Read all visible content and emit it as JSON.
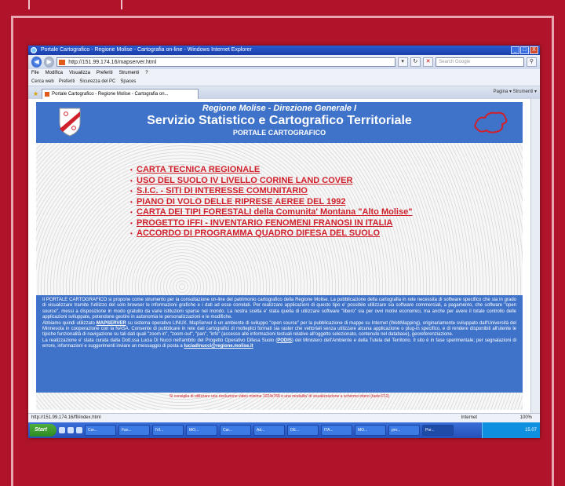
{
  "window": {
    "title": "Portale Cartografico - Regione Molise - Cartografia on-line - Windows Internet Explorer",
    "controls": [
      "_",
      "□",
      "X"
    ]
  },
  "address_bar": {
    "url": "http://151.99.174.16/mapserver.html",
    "search_placeholder": "Search Google"
  },
  "menu_bar": [
    "File",
    "Modifica",
    "Visualizza",
    "Preferiti",
    "Strumenti",
    "?"
  ],
  "links_bar": [
    "Cerca web",
    "Preferiti",
    "Sicurezza del PC",
    "Spaces"
  ],
  "tab": {
    "label": "Portale Cartografico - Regione Molise - Cartografia on...",
    "commands": "Pagina ▾   Strumenti ▾"
  },
  "page": {
    "header": {
      "line1": "Regione Molise - Direzione Generale I",
      "line2": "Servizio Statistico e Cartografico Territoriale",
      "line3": "PORTALE CARTOGRAFICO"
    },
    "menu_links": [
      "CARTA TECNICA REGIONALE",
      "USO DEL SUOLO IV LIVELLO CORINE LAND COVER",
      "S.I.C. - SITI DI INTERESSE COMUNITARIO",
      "PIANO DI VOLO DELLE RIPRESE AEREE DEL 1992",
      "CARTA DEI TIPI FORESTALI della Comunita' Montana \"Alto Molise\"",
      "PROGETTO IFFI - INVENTARIO FENOMENI FRANOSI IN ITALIA",
      "ACCORDO DI PROGRAMMA QUADRO DIFESA DEL SUOLO"
    ],
    "info": {
      "p1": "Il PORTALE CARTOGRAFICO si propone come strumento per la consultazione on-line del patrimonio cartografico della Regione Molise. La pubblicazione della cartografia in rete necessita di software specifico che sia in grado di visualizzare tramite l'utilizzo del solo browser le informazioni grafiche e i dati ad esse correlati. Per realizzare applicazioni di questo tipo e' possibile utilizzare sia software commerciali, a pagamento, che software \"open source\", messi a disposizione in modo gratuito da varie istituzioni sparse nel mondo. La nostra scelta e' stata quella di utilizzare software \"libero\" sia per ovvi motivi economici, ma anche per avere il totale controllo delle applicazioni sviluppate, potendone gestire in autonomia le personalizzazioni e le modifiche.",
      "p2a": "Abbiamo quindi utilizzato ",
      "mapserver": "MAPSERVER",
      "p2b": " su sistema operativo LINUX. MapServer è un ambiente di sviluppo \"open source\" per la pubblicazione di mappe su Internet (WebMapping), originariamente sviluppato dall'Università del Minnesota in cooperazione con la NASA. Consente di pubblicare in rete dati cartografici di molteplici formati sia raster che vettoriali senza utilizzare alcuna applicazione o plug-in specifico, e di rendere disponibili all'utente le tipiche funzionalità di navigazione su tali dati quali \"zoom in\", \"zoom out\", \"pan\", \"info\" (accesso alle informazioni testuali relative all'oggetto selezionato, contenute nel database), georeferenziazione.",
      "p3a": "La realizzazione e' stata curata dalla Dott.ssa Lucia Di Nucci nell'ambito del Progetto Operativo Difesa Suolo (",
      "podis": "PODIS",
      "p3b": ") del Ministero dell'Ambiente e della Tutela del Territorio. Il sito è in fase sperimentale; per segnalazioni di errore, informazioni e suggerimenti inviare un messaggio di posta a ",
      "email": "luciadinucci@regione.molise.it"
    },
    "hint": "Si consiglia di utilizzare una risoluzione video minima 1024x768 e una modalita' di visualizzazione a schermo intero (tasto F11)"
  },
  "status_bar": {
    "url": "http://151.99.174.16/ffi/index.html",
    "zone": "Internet",
    "zoom": "100%"
  },
  "taskbar": {
    "start": "Start",
    "tasks": [
      "Cor...",
      "Fax...",
      "IVI...",
      "MO...",
      "Car...",
      "Ad...",
      "DE...",
      "ITA...",
      "MO...",
      "pro...",
      "Por..."
    ],
    "clock": "15.07"
  },
  "colors": {
    "background": "#b0142a",
    "banner": "#3f73c9",
    "link": "#d0202c"
  }
}
